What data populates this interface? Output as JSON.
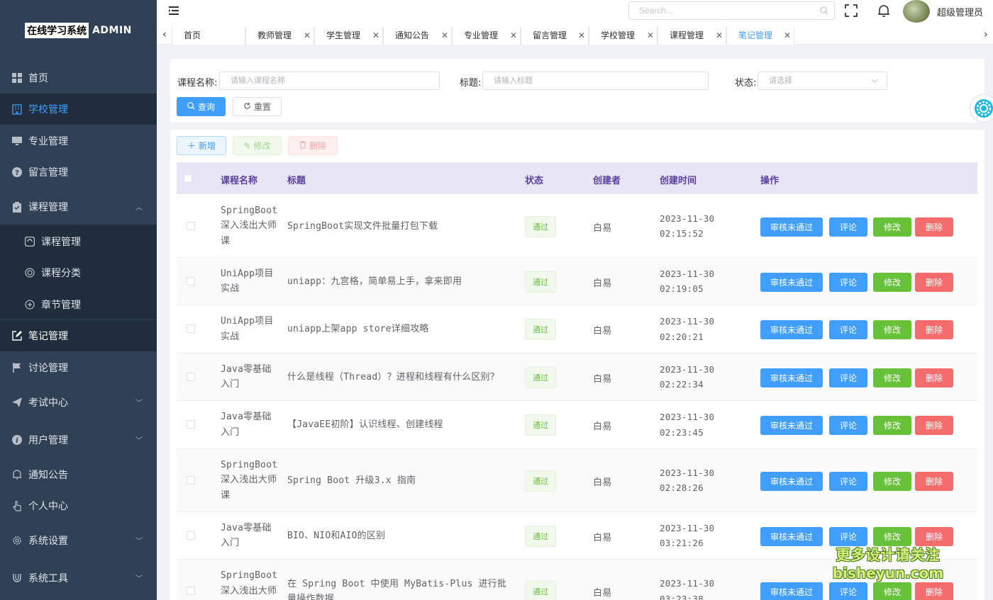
{
  "app": {
    "logo_text": "在线学习系统",
    "logo_suffix": "ADMIN"
  },
  "sidebar": {
    "items": [
      {
        "label": "首页",
        "icon": "dashboard-icon"
      },
      {
        "label": "学校管理",
        "icon": "building-icon"
      },
      {
        "label": "专业管理",
        "icon": "monitor-icon"
      },
      {
        "label": "留言管理",
        "icon": "question-icon"
      },
      {
        "label": "课程管理",
        "icon": "clipboard-check-icon"
      },
      {
        "label": "课程管理",
        "icon": "edit-square-icon"
      },
      {
        "label": "课程分类",
        "icon": "grid-circle-icon"
      },
      {
        "label": "章节管理",
        "icon": "plus-circle-icon"
      },
      {
        "label": "笔记管理",
        "icon": "edit-icon"
      },
      {
        "label": "讨论管理",
        "icon": "flag-icon"
      },
      {
        "label": "考试中心",
        "icon": "send-icon"
      },
      {
        "label": "用户管理",
        "icon": "info-icon"
      },
      {
        "label": "通知公告",
        "icon": "bell-icon"
      },
      {
        "label": "个人中心",
        "icon": "pointer-icon"
      },
      {
        "label": "系统设置",
        "icon": "gear-icon"
      },
      {
        "label": "系统工具",
        "icon": "magnet-icon"
      }
    ]
  },
  "topbar": {
    "search_placeholder": "Search...",
    "username": "超级管理员"
  },
  "tabs": [
    {
      "label": "首页"
    },
    {
      "label": "教师管理"
    },
    {
      "label": "学生管理"
    },
    {
      "label": "通知公告"
    },
    {
      "label": "专业管理"
    },
    {
      "label": "留言管理"
    },
    {
      "label": "学校管理"
    },
    {
      "label": "课程管理"
    },
    {
      "label": "笔记管理"
    }
  ],
  "filters": {
    "course_label": "课程名称:",
    "course_placeholder": "请输入课程名称",
    "title_label": "标题:",
    "title_placeholder": "请输入标题",
    "status_label": "状态:",
    "status_placeholder": "请选择",
    "query_label": "查询",
    "reset_label": "重置"
  },
  "toolbar": {
    "add_label": "新增",
    "edit_label": "修改",
    "delete_label": "删除"
  },
  "table": {
    "headers": {
      "course": "课程名称",
      "title": "标题",
      "status": "状态",
      "creator": "创建者",
      "created": "创建时间",
      "actions": "操作"
    },
    "actions": {
      "review": "审核未通过",
      "comment": "评论",
      "edit": "修改",
      "delete": "删除"
    },
    "rows": [
      {
        "course": "SpringBoot深入浅出大师课",
        "title": "SpringBoot实现文件批量打包下载",
        "status": "通过",
        "creator": "白易",
        "created": "2023-11-30 02:15:52"
      },
      {
        "course": "UniApp项目实战",
        "title": "uniapp：九宫格，简单易上手，拿来即用",
        "status": "通过",
        "creator": "白易",
        "created": "2023-11-30 02:19:05"
      },
      {
        "course": "UniApp项目实战",
        "title": "uniapp上架app store详细攻略",
        "status": "通过",
        "creator": "白易",
        "created": "2023-11-30 02:20:21"
      },
      {
        "course": "Java零基础入门",
        "title": "什么是线程（Thread）？进程和线程有什么区别？",
        "status": "通过",
        "creator": "白易",
        "created": "2023-11-30 02:22:34"
      },
      {
        "course": "Java零基础入门",
        "title": "【JavaEE初阶】认识线程、创建线程",
        "status": "通过",
        "creator": "白易",
        "created": "2023-11-30 02:23:45"
      },
      {
        "course": "SpringBoot深入浅出大师课",
        "title": "Spring Boot 升级3.x 指南",
        "status": "通过",
        "creator": "白易",
        "created": "2023-11-30 02:28:26"
      },
      {
        "course": "Java零基础入门",
        "title": "BIO、NIO和AIO的区别",
        "status": "通过",
        "creator": "白易",
        "created": "2023-11-30 03:21:26"
      },
      {
        "course": "SpringBoot深入浅出大师课",
        "title": "在 Spring Boot 中使用 MyBatis-Plus 进行批量操作数据",
        "status": "通过",
        "creator": "白易",
        "created": "2023-11-30 03:23:38"
      }
    ]
  },
  "watermark": {
    "line1": "更多设计请关注",
    "line2": "bisheyun.com"
  },
  "colors": {
    "primary": "#409eff",
    "success": "#67c23a",
    "danger": "#f56c6c",
    "sidebar": "#304156",
    "header_row": "#e8e6f6"
  }
}
